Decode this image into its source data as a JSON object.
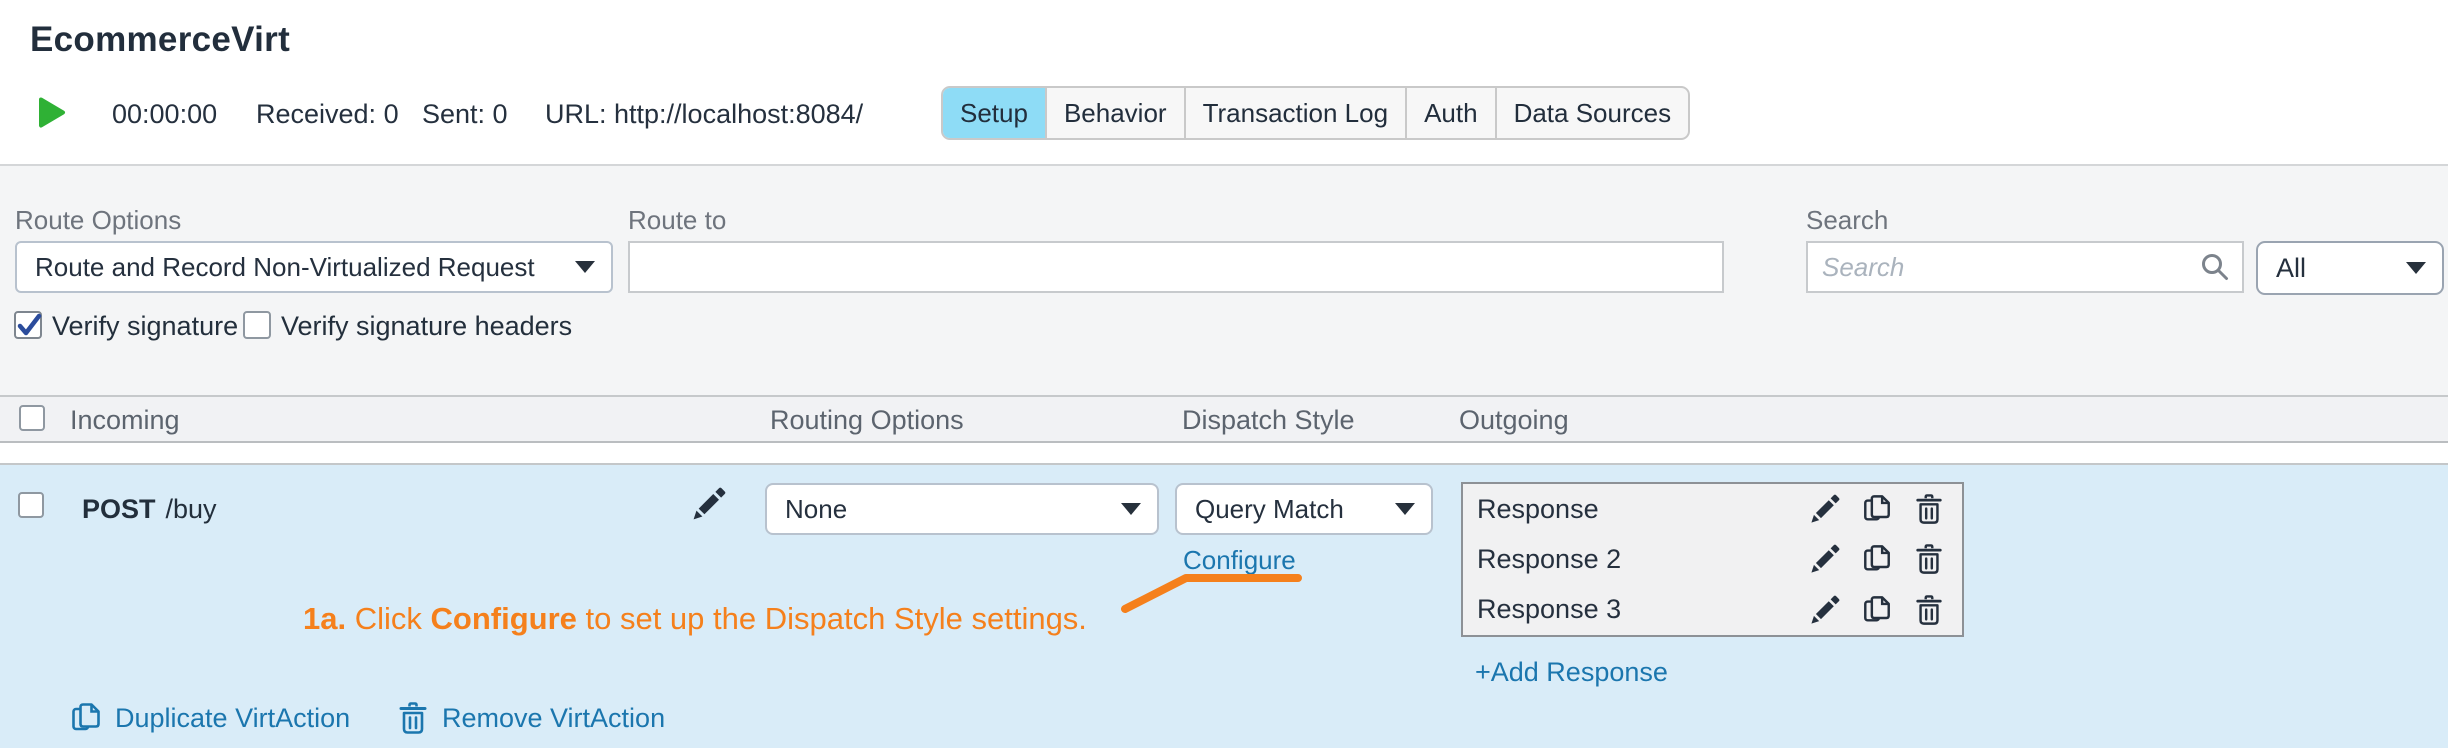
{
  "header": {
    "title": "EcommerceVirt",
    "timer": "00:00:00",
    "received": "Received: 0",
    "sent": "Sent: 0",
    "url": "URL: http://localhost:8084/",
    "tabs": [
      {
        "label": "Setup",
        "active": true
      },
      {
        "label": "Behavior",
        "active": false
      },
      {
        "label": "Transaction Log",
        "active": false
      },
      {
        "label": "Auth",
        "active": false
      },
      {
        "label": "Data Sources",
        "active": false
      }
    ]
  },
  "filters": {
    "route_options_label": "Route Options",
    "route_options_value": "Route and Record Non-Virtualized Request",
    "route_to_label": "Route to",
    "route_to_value": "",
    "search_label": "Search",
    "search_placeholder": "Search",
    "search_value": "",
    "scope_value": "All",
    "verify_signature_label": "Verify signature",
    "verify_signature_checked": true,
    "verify_signature_headers_label": "Verify signature headers",
    "verify_signature_headers_checked": false
  },
  "table": {
    "columns": [
      "Incoming",
      "Routing Options",
      "Dispatch Style",
      "Outgoing"
    ],
    "row": {
      "method": "POST",
      "path": "/buy",
      "routing_option_value": "None",
      "dispatch_style_value": "Query Match",
      "configure_label": "Configure",
      "responses": [
        "Response",
        "Response 2",
        "Response 3"
      ],
      "add_response_label": "+Add Response",
      "duplicate_label": "Duplicate VirtAction",
      "remove_label": "Remove VirtAction"
    }
  },
  "annotation": {
    "step": "1a.",
    "pre": " Click ",
    "emphasis": "Configure",
    "post": " to set up the Dispatch Style settings."
  },
  "colors": {
    "accent_orange": "#f5801c",
    "link_blue": "#1b76ae",
    "active_tab_blue": "#8edcf6",
    "row_blue": "#d9ecf8",
    "play_green": "#2fb135",
    "check_blue": "#2b4c9c"
  }
}
